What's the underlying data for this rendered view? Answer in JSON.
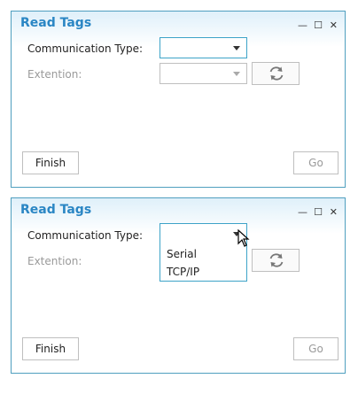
{
  "dialog1": {
    "title": "Read Tags",
    "window_controls": {
      "minimize": "—",
      "maximize": "☐",
      "close": "✕"
    },
    "communication_type_label": "Communication Type:",
    "communication_type_value": "",
    "extention_label": "Extention:",
    "finish_label": "Finish",
    "go_label": "Go"
  },
  "dialog2": {
    "title": "Read Tags",
    "window_controls": {
      "minimize": "—",
      "maximize": "☐",
      "close": "✕"
    },
    "communication_type_label": "Communication Type:",
    "communication_type_value": "",
    "extention_label": "Extention:",
    "dropdown_options": [
      "Serial",
      "TCP/IP"
    ],
    "finish_label": "Finish",
    "go_label": "Go"
  },
  "icons": {
    "refresh": "refresh-icon",
    "dropdown": "chevron-down-icon",
    "cursor": "mouse-pointer-icon"
  },
  "colors": {
    "title": "#2a86c4",
    "border": "#4f9fbf",
    "focus_border": "#3da3c8",
    "disabled_text": "#9a9a9a"
  }
}
